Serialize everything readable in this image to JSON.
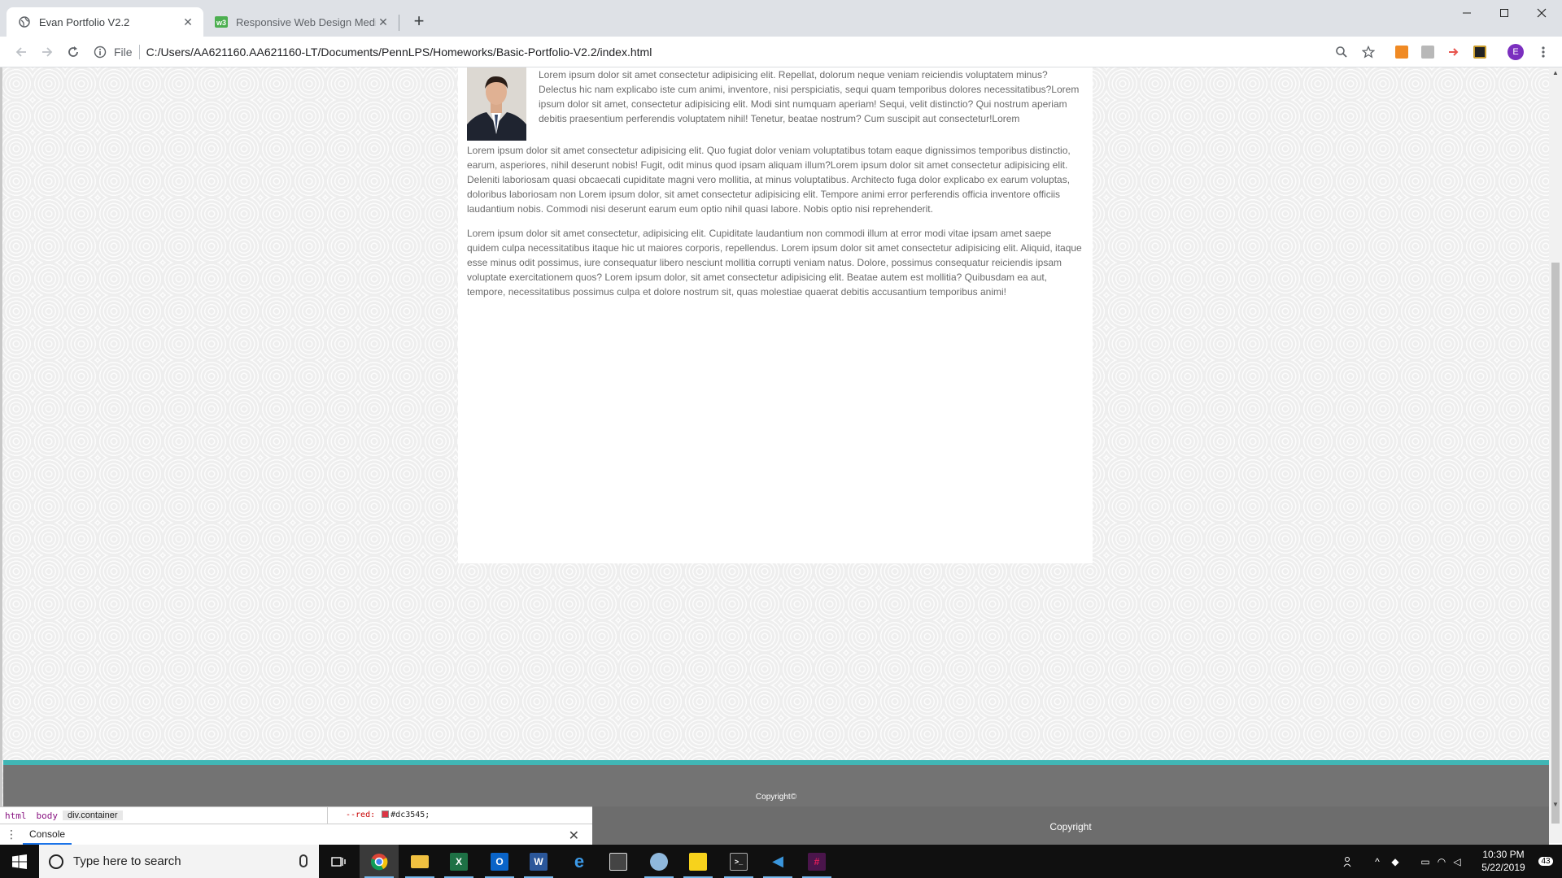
{
  "tabs": [
    {
      "title": "Evan Portfolio V2.2",
      "active": true
    },
    {
      "title": "Responsive Web Design Media Q",
      "active": false
    }
  ],
  "toolbar": {
    "scheme": "File",
    "url": "C:/Users/AA621160.AA621160-LT/Documents/PennLPS/Homeworks/Basic-Portfolio-V2.2/index.html",
    "profile_initial": "E"
  },
  "page": {
    "intro_text": "Lorem ipsum dolor sit amet consectetur adipisicing elit. Repellat, dolorum neque veniam reiciendis voluptatem minus? Delectus hic nam explicabo iste cum animi, inventore, nisi perspiciatis, sequi quam temporibus dolores necessitatibus?Lorem ipsum dolor sit amet, consectetur adipisicing elit. Modi sint numquam aperiam! Sequi, velit distinctio? Qui nostrum aperiam debitis praesentium perferendis voluptatem nihil! Tenetur, beatae nostrum? Cum suscipit aut consectetur!Lorem",
    "paragraph_2": "Lorem ipsum dolor sit amet consectetur adipisicing elit. Quo fugiat dolor veniam voluptatibus totam eaque dignissimos temporibus distinctio, earum, asperiores, nihil deserunt nobis! Fugit, odit minus quod ipsam aliquam illum?Lorem ipsum dolor sit amet consectetur adipisicing elit. Deleniti laboriosam quasi obcaecati cupiditate magni vero mollitia, at minus voluptatibus. Architecto fuga dolor explicabo ex earum voluptas, doloribus laboriosam non Lorem ipsum dolor, sit amet consectetur adipisicing elit. Tempore animi error perferendis officia inventore officiis laudantium nobis. Commodi nisi deserunt earum eum optio nihil quasi labore. Nobis optio nisi reprehenderit.",
    "paragraph_3": "Lorem ipsum dolor sit amet consectetur, adipisicing elit. Cupiditate laudantium non commodi illum at error modi vitae ipsam amet saepe quidem culpa necessitatibus itaque hic ut maiores corporis, repellendus. Lorem ipsum dolor sit amet consectetur adipisicing elit. Aliquid, itaque esse minus odit possimus, iure consequatur libero nesciunt mollitia corrupti veniam natus. Dolore, possimus consequatur reiciendis ipsam voluptate exercitationem quos? Lorem ipsum dolor, sit amet consectetur adipisicing elit. Beatae autem est mollitia? Quibusdam ea aut, tempore, necessitatibus possimus culpa et dolore nostrum sit, quas molestiae quaerat debitis accusantium temporibus animi!",
    "footer_copyright": "Copyright©",
    "footer_color": "#737373",
    "footer_accent": "#40b6b5"
  },
  "devtools": {
    "breadcrumbs": [
      "html",
      "body",
      "div.container"
    ],
    "style_prop": "--red:",
    "style_value": "#dc3545;",
    "style_color": "#dc3545",
    "drawer_tab": "Console"
  },
  "footer2_text": "Copyright",
  "taskbar": {
    "search_placeholder": "Type here to search",
    "time": "10:30 PM",
    "date": "5/22/2019",
    "notifications": "43"
  }
}
